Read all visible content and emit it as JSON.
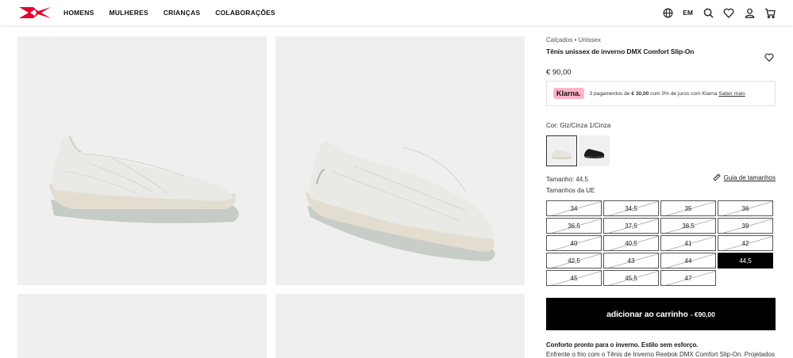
{
  "header": {
    "logo_alt": "Reebok",
    "nav": [
      "HOMENS",
      "MULHERES",
      "CRIANÇAS",
      "COLABORAÇÕES"
    ],
    "language": "EM",
    "brand_color": "#e4002b"
  },
  "product": {
    "breadcrumb": "Calçados • Unissex",
    "title": "Tênis unissex de inverno DMX Comfort Slip-On",
    "price": "€ 90,00",
    "klarna": {
      "logo": "Klarna.",
      "text_prefix": "3 pagamentos de",
      "amount": "€ 30,00",
      "text_suffix": "com 0% de juros com Klarna",
      "link": "Saber mais"
    },
    "color_label": "Cor: Giz/Cinza 1/Cinza",
    "size_label": "Tamanho: 44,5",
    "size_guide": "Guia de tamanhos",
    "eu_label": "Tamanhos da UE",
    "sizes": [
      "34",
      "34,5",
      "35",
      "36",
      "36,5",
      "37,5",
      "38,5",
      "39",
      "40",
      "40,5",
      "41",
      "42",
      "42,5",
      "43",
      "44",
      "44,5",
      "45",
      "45,5",
      "47"
    ],
    "selected_size": "44,5",
    "cart_label": "adicionar ao carrinho",
    "cart_price": "- €90,00",
    "desc_title": "Conforto pronto para o inverno. Estilo sem esforço.",
    "desc_text": "Enfrente o frio com o Tênis de Inverno Reebok DMX Comfort Slip-On. Projetados"
  }
}
